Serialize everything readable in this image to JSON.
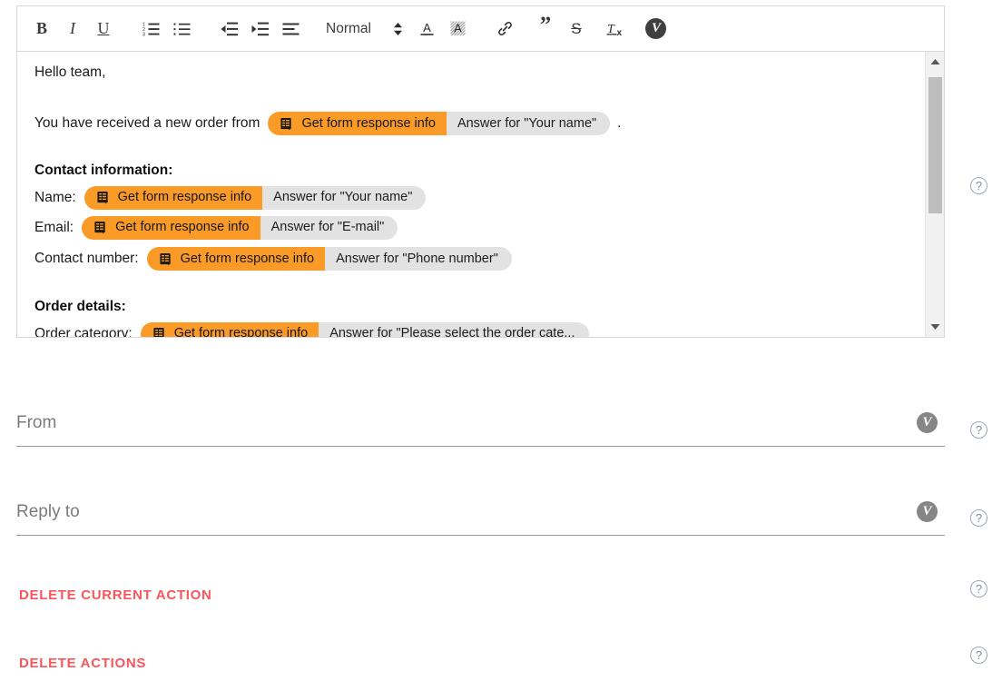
{
  "editor": {
    "toolbar": {
      "buttons": [
        {
          "name": "bold",
          "label": "B",
          "title": "Bold"
        },
        {
          "name": "italic",
          "label": "I",
          "title": "Italic"
        },
        {
          "name": "underline",
          "label": "U",
          "title": "Underline"
        },
        {
          "name": "ordered-list",
          "label": "",
          "title": "Numbered list"
        },
        {
          "name": "bullet-list",
          "label": "",
          "title": "Bulleted list"
        },
        {
          "name": "outdent",
          "label": "",
          "title": "Decrease indent"
        },
        {
          "name": "indent",
          "label": "",
          "title": "Increase indent"
        },
        {
          "name": "align",
          "label": "",
          "title": "Align"
        },
        {
          "name": "text-color",
          "label": "A",
          "title": "Text color"
        },
        {
          "name": "highlight-color",
          "label": "A",
          "title": "Background color"
        },
        {
          "name": "link",
          "label": "",
          "title": "Insert link"
        },
        {
          "name": "blockquote",
          "label": "”",
          "title": "Blockquote"
        },
        {
          "name": "strikethrough",
          "label": "S",
          "title": "Strikethrough"
        },
        {
          "name": "clear-format",
          "label": "Tx",
          "title": "Clear formatting"
        },
        {
          "name": "variable-picker",
          "label": "V",
          "title": "Insert variable"
        }
      ],
      "style_select": {
        "value": "Normal"
      }
    },
    "content": {
      "greeting": "Hello team,",
      "intro_prefix": "You have received a new order from",
      "intro_suffix": ".",
      "contact_heading": "Contact information:",
      "order_heading": "Order details:",
      "labels": {
        "name": "Name:",
        "email": "Email:",
        "contact_number": "Contact number:",
        "order_category": "Order category:"
      },
      "pills": {
        "source_label": "Get form response info",
        "intro_answer": "Answer for \"Your name\"",
        "name_answer": "Answer for \"Your name\"",
        "email_answer": "Answer for \"E-mail\"",
        "phone_answer": "Answer for \"Phone number\"",
        "category_answer": "Answer for \"Please select the order cate..."
      }
    },
    "scrollbar": {
      "up_arrow": "▲",
      "down_arrow": "▼"
    }
  },
  "fields": [
    {
      "name": "from",
      "placeholder": "From",
      "value": "",
      "badge": "V"
    },
    {
      "name": "reply-to",
      "placeholder": "Reply to",
      "value": "",
      "badge": "V"
    }
  ],
  "actions": [
    {
      "name": "delete-current-action",
      "label": "DELETE CURRENT ACTION"
    },
    {
      "name": "delete-actions",
      "label": "DELETE ACTIONS"
    }
  ],
  "help_icons": [
    {
      "name": "help-editor",
      "glyph": "?"
    },
    {
      "name": "help-from",
      "glyph": "?"
    },
    {
      "name": "help-reply-to",
      "glyph": "?"
    },
    {
      "name": "help-delete-current-action",
      "glyph": "?"
    },
    {
      "name": "help-delete-actions",
      "glyph": "?"
    }
  ],
  "colors": {
    "pill_orange": "#fa9b28",
    "pill_gray": "#e2e2e2",
    "danger": "#f9555b",
    "help_border": "#9aa7b8",
    "scroll_thumb": "#bdbdbd"
  }
}
